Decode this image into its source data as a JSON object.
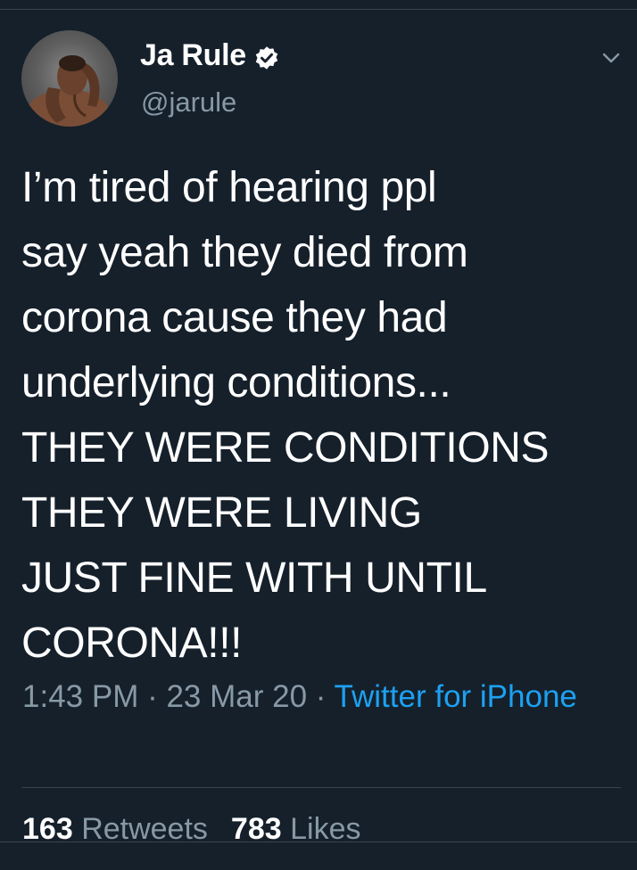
{
  "author": {
    "display_name": "Ja Rule",
    "handle": "@jarule",
    "verified": true,
    "avatar_icon": "profile-photo"
  },
  "tweet": {
    "text": "I’m tired of hearing ppl\nsay yeah they died from\ncorona cause they had\nunderlying conditions...\nTHEY WERE CONDITIONS\nTHEY WERE LIVING\nJUST FINE WITH UNTIL\nCORONA!!!",
    "time": "1:43 PM",
    "separator": " · ",
    "date": "23 Mar 20",
    "source": "Twitter for iPhone"
  },
  "stats": {
    "retweets_count": "163",
    "retweets_label": "Retweets",
    "likes_count": "783",
    "likes_label": "Likes"
  },
  "colors": {
    "background": "#15202b",
    "text": "#ffffff",
    "secondary_text": "#8899a6",
    "accent": "#1da1f2",
    "divider": "#38444d"
  },
  "icons": {
    "verified": "verified-badge-icon",
    "menu": "chevron-down-icon"
  }
}
